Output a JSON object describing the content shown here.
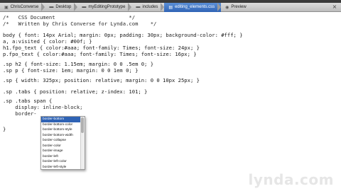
{
  "pathbar": {
    "crumbs": [
      {
        "label": "ChrisConverse",
        "icon": "drive-icon"
      },
      {
        "label": "Desktop",
        "icon": "folder-icon"
      },
      {
        "label": "myEditingPrototype",
        "icon": "folder-icon"
      },
      {
        "label": "includes",
        "icon": "folder-icon"
      },
      {
        "label": "editing_elements.css",
        "icon": "css-file-icon"
      },
      {
        "label": "Preview",
        "icon": "preview-icon"
      }
    ],
    "close": "×"
  },
  "code": [
    "/*   CSS Document                        */",
    "/*   Written by Chris Converse for Lynda.com    */",
    "",
    "body { font: 14px Arial; margin: 0px; padding: 30px; background-color: #fff; }",
    "a, a:visited { color: #00f; }",
    "h1.fpo_text { color:#aaa; font-family: Times; font-size: 24px; }",
    "p.fpo_text { color:#aaa; font-family: Times; font-size: 16px; }",
    "",
    ".sp h2 { font-size: 1.15em; margin: 0 0 .5em 0; }",
    ".sp p { font-size: 1em; margin: 0 0 1em 0; }",
    "",
    ".sp { width: 325px; position: relative; margin: 0 0 10px 25px; }",
    "",
    ".sp .tabs { position: relative; z-index: 101; }",
    "",
    ".sp .tabs span {",
    "    display: inline-block;",
    "    border-",
    "",
    "}"
  ],
  "autocomplete": {
    "items": [
      "border-bottom",
      "border-bottom-color",
      "border-bottom-style",
      "border-bottom-width",
      "border-collapse",
      "border-color",
      "border-image",
      "border-left",
      "border-left-color",
      "border-left-style"
    ],
    "selected_index": 0
  },
  "watermark": "lynda.com",
  "colors": {
    "selection": "#2f63b5",
    "pathbar": "#c8c8c8",
    "editor_bg": "#ffffff"
  }
}
